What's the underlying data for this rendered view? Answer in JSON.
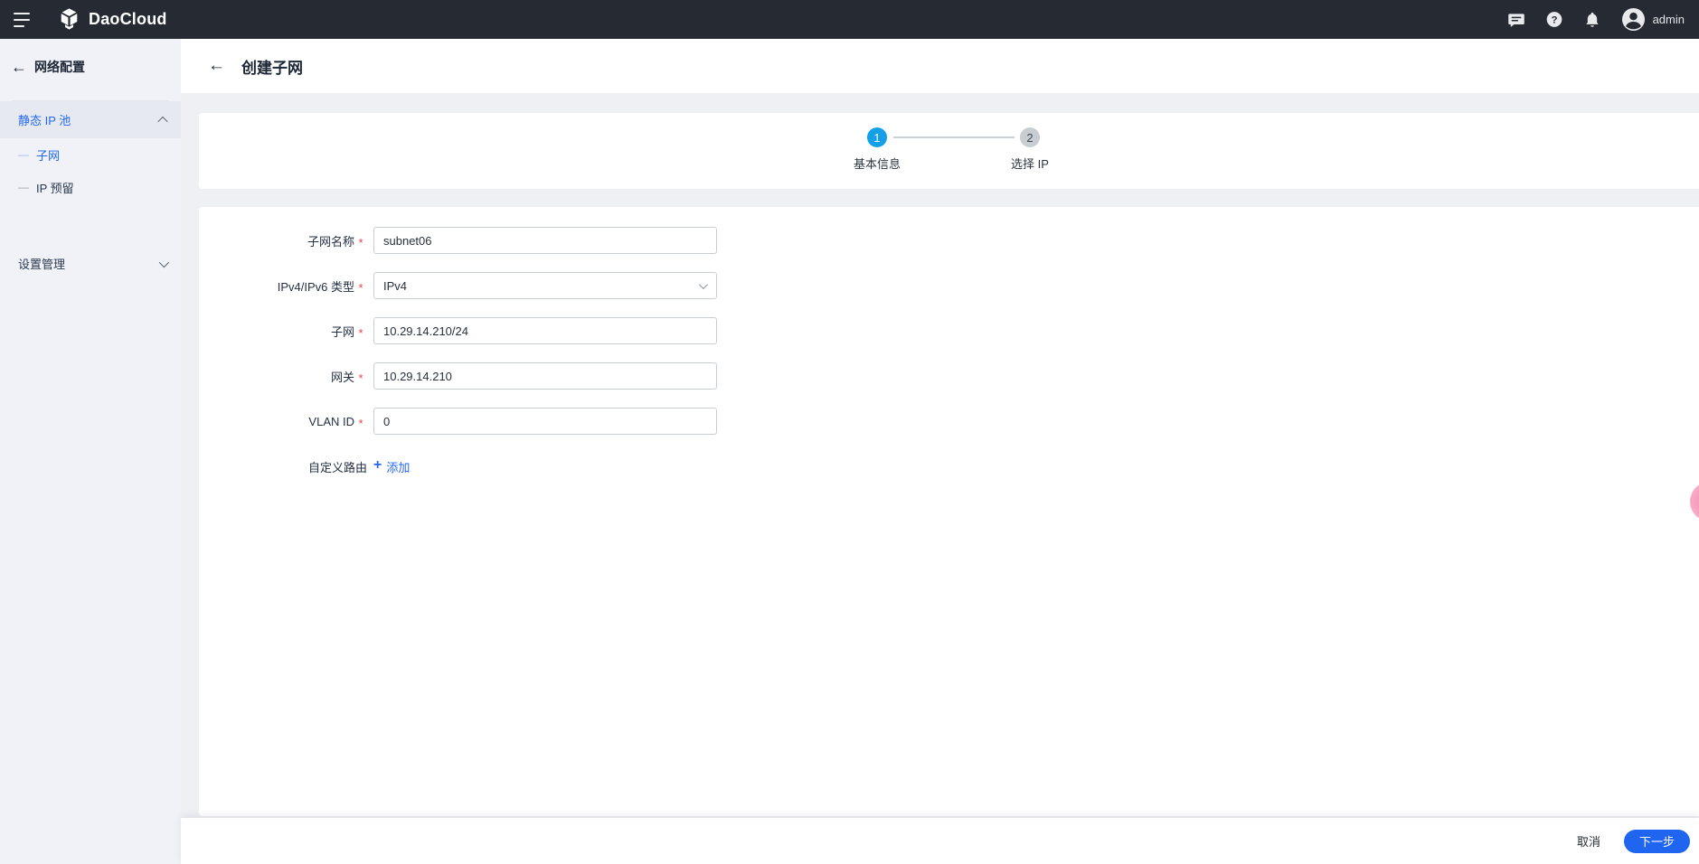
{
  "icons": {
    "back_arrow": "←",
    "plus": "+",
    "child_bullet": "—"
  },
  "topbar": {
    "brand": "DaoCloud",
    "user": "admin"
  },
  "sidebar": {
    "title": "网络配置",
    "sections": [
      {
        "label": "静态 IP 池",
        "state": "expanded",
        "children": [
          {
            "label": "子网",
            "active": true
          },
          {
            "label": "IP 预留",
            "active": false
          }
        ]
      },
      {
        "label": "设置管理",
        "state": "collapsed",
        "children": []
      }
    ]
  },
  "page": {
    "title": "创建子网"
  },
  "stepper": {
    "steps": [
      {
        "num": "1",
        "label": "基本信息",
        "active": true
      },
      {
        "num": "2",
        "label": "选择 IP",
        "active": false
      }
    ]
  },
  "form": {
    "required_marker": "*",
    "fields": [
      {
        "label": "子网名称",
        "required": true,
        "type": "text",
        "value": "subnet06"
      },
      {
        "label": "IPv4/IPv6 类型",
        "required": true,
        "type": "select",
        "value": "IPv4"
      },
      {
        "label": "子网",
        "required": true,
        "type": "text",
        "value": "10.29.14.210/24"
      },
      {
        "label": "网关",
        "required": true,
        "type": "text",
        "value": "10.29.14.210"
      },
      {
        "label": "VLAN ID",
        "required": true,
        "type": "text",
        "value": "0"
      },
      {
        "label": "自定义路由",
        "required": false,
        "type": "link",
        "link_label": "添加"
      }
    ]
  },
  "footer": {
    "cancel_label": "取消",
    "next_label": "下一步"
  },
  "colors": {
    "accent": "#2468f2",
    "step_active": "#14a0e8",
    "topbar_bg": "#262a32",
    "required": "#e54545",
    "pink_fab": "#f7a8c4"
  }
}
